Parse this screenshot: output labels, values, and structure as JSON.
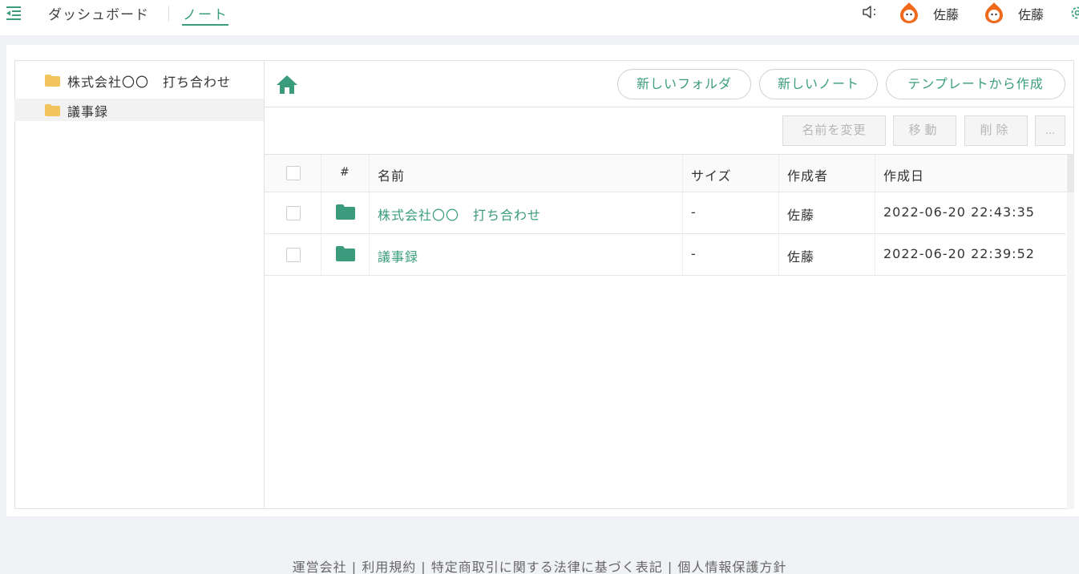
{
  "header": {
    "menu_icon": "menu-collapse-icon",
    "nav": {
      "dashboard": "ダッシュボード",
      "notes": "ノート"
    },
    "users": [
      {
        "name": "佐藤"
      },
      {
        "name": "佐藤"
      }
    ],
    "icons": {
      "speaker": "speaker-icon",
      "settings": "gear-icon"
    }
  },
  "sidebar": {
    "items": [
      {
        "label": "株式会社〇〇　打ち合わせ",
        "selected": false
      },
      {
        "label": "議事録",
        "selected": true
      }
    ]
  },
  "toolbar": {
    "new_folder": "新しいフォルダ",
    "new_note": "新しいノート",
    "from_template": "テンプレートから作成",
    "rename": "名前を変更",
    "move": "移動",
    "delete": "削除",
    "more": "..."
  },
  "table": {
    "columns": {
      "num": "#",
      "name": "名前",
      "size": "サイズ",
      "author": "作成者",
      "created": "作成日"
    },
    "rows": [
      {
        "name": "株式会社〇〇　打ち合わせ",
        "size": "-",
        "author": "佐藤",
        "created": "2022-06-20 22:43:35"
      },
      {
        "name": "議事録",
        "size": "-",
        "author": "佐藤",
        "created": "2022-06-20 22:39:52"
      }
    ]
  },
  "footer": {
    "text": "運営会社 | 利用規約 | 特定商取引に関する法律に基づく表記 | 個人情報保護方針"
  },
  "colors": {
    "accent": "#3a9c7c",
    "folder_sidebar": "#f2c45e",
    "folder_table": "#3a9c7c",
    "avatar": "#f06a1e"
  }
}
